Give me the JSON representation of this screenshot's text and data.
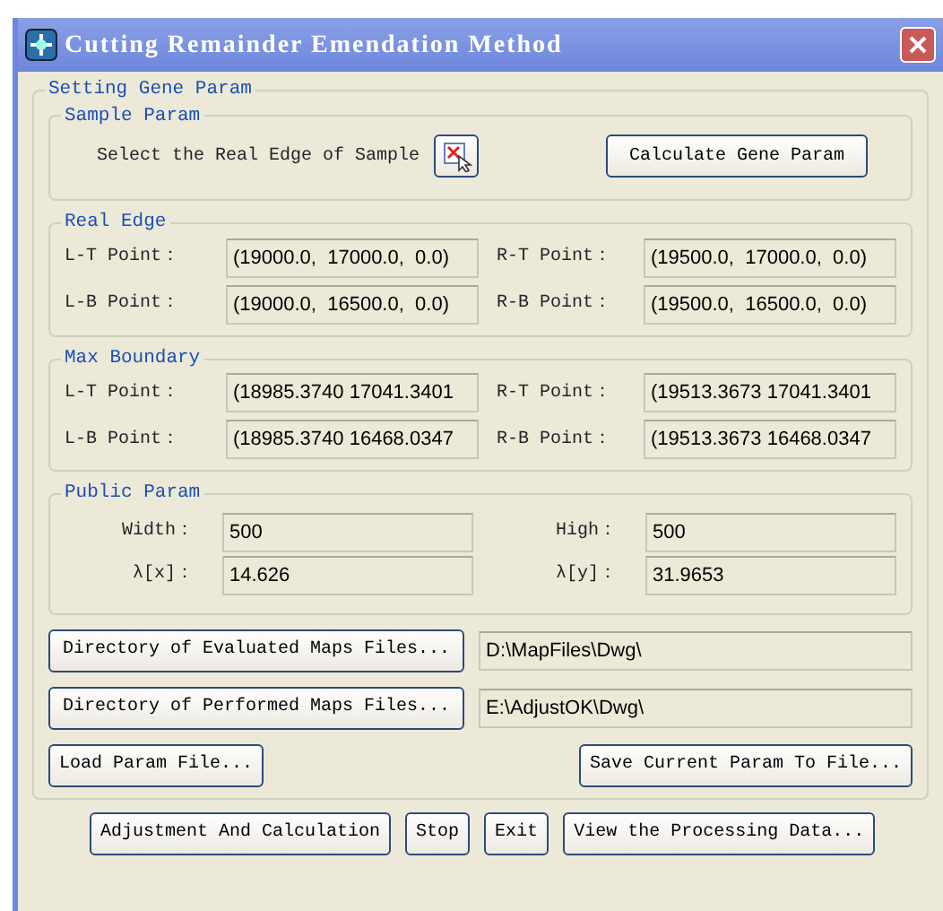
{
  "window": {
    "title": "Cutting Remainder Emendation Method"
  },
  "main_group": {
    "title": "Setting Gene Param"
  },
  "sample_param": {
    "title": "Sample Param",
    "label": "Select the Real Edge of Sample",
    "button": "Calculate Gene Param"
  },
  "point_groups": [
    {
      "title": "Real Edge",
      "fields": [
        {
          "label": "L-T Point：",
          "value": "(19000.0,  17000.0,  0.0)"
        },
        {
          "label": "R-T Point：",
          "value": "(19500.0,  17000.0,  0.0)"
        },
        {
          "label": "L-B Point：",
          "value": "(19000.0,  16500.0,  0.0)"
        },
        {
          "label": "R-B Point：",
          "value": "(19500.0,  16500.0,  0.0)"
        }
      ]
    },
    {
      "title": "Max Boundary",
      "fields": [
        {
          "label": "L-T Point：",
          "value": "(18985.3740 17041.3401"
        },
        {
          "label": "R-T Point：",
          "value": "(19513.3673 17041.3401"
        },
        {
          "label": "L-B Point：",
          "value": "(18985.3740 16468.0347"
        },
        {
          "label": "R-B Point：",
          "value": "(19513.3673 16468.0347"
        }
      ]
    }
  ],
  "public_param": {
    "title": "Public Param",
    "fields": [
      {
        "label": "Width：",
        "value": "500"
      },
      {
        "label": "High：",
        "value": "500"
      },
      {
        "label": "λ[x]：",
        "value": "14.626"
      },
      {
        "label": "λ[y]：",
        "value": "31.9653"
      }
    ]
  },
  "directories": [
    {
      "button": "Directory of Evaluated Maps Files...",
      "value": "D:\\MapFiles\\Dwg\\"
    },
    {
      "button": "Directory of Performed Maps Files...",
      "value": "E:\\AdjustOK\\Dwg\\"
    }
  ],
  "file_buttons": [
    "Load Param File...",
    "Save Current Param To File..."
  ],
  "buttons": [
    "Adjustment And Calculation",
    "Stop",
    "Exit",
    "View the Processing Data..."
  ]
}
